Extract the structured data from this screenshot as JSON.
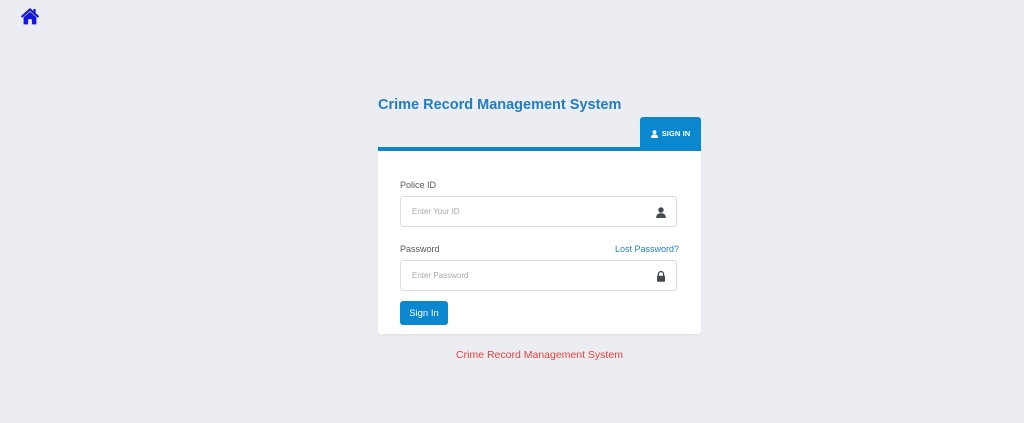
{
  "header": {
    "home_icon": "home-icon"
  },
  "login": {
    "title": "Crime Record Management System",
    "tab": {
      "label": "SIGN IN",
      "icon": "user-icon"
    },
    "police_id": {
      "label": "Police ID",
      "placeholder": "Enter Your ID",
      "value": "",
      "icon": "user-icon"
    },
    "password": {
      "label": "Password",
      "placeholder": "Enter Password",
      "value": "",
      "icon": "lock-icon"
    },
    "lost_password_label": "Lost Password?",
    "submit_label": "Sign In"
  },
  "footer": {
    "text": "Crime Record Management System"
  },
  "colors": {
    "background": "#ebedf2",
    "accent": "#0b87d0",
    "title": "#1f7ec4",
    "home_icon": "#1515e0",
    "footer_text": "#e8413c"
  }
}
